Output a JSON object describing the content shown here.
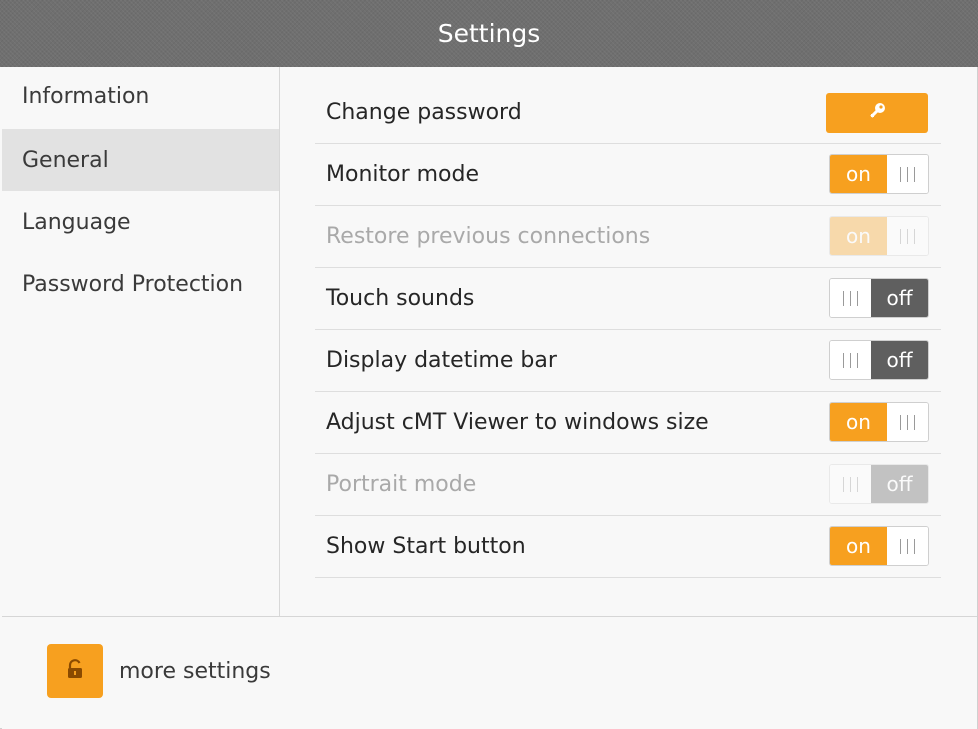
{
  "window": {
    "title": "Settings"
  },
  "sidebar": {
    "items": [
      {
        "label": "Information",
        "selected": false
      },
      {
        "label": "General",
        "selected": true
      },
      {
        "label": "Language",
        "selected": false
      },
      {
        "label": "Password Protection",
        "selected": false
      }
    ]
  },
  "settings": {
    "change_password": {
      "label": "Change password",
      "button_icon": "key-icon"
    },
    "monitor_mode": {
      "label": "Monitor mode",
      "state": "on",
      "enabled": true
    },
    "restore_connections": {
      "label": "Restore previous connections",
      "state": "on",
      "enabled": false
    },
    "touch_sounds": {
      "label": "Touch sounds",
      "state": "off",
      "enabled": true
    },
    "datetime_bar": {
      "label": "Display datetime bar",
      "state": "off",
      "enabled": true
    },
    "adjust_viewer": {
      "label": "Adjust cMT Viewer to windows size",
      "state": "on",
      "enabled": true
    },
    "portrait_mode": {
      "label": "Portrait mode",
      "state": "off",
      "enabled": false
    },
    "show_start": {
      "label": "Show Start button",
      "state": "on",
      "enabled": true
    }
  },
  "footer": {
    "more_label": "more settings",
    "lock_icon": "unlock-icon"
  },
  "colors": {
    "accent": "#f7a01f",
    "off_fill": "#5f5f5f",
    "titlebar": "#6f6f6f"
  }
}
